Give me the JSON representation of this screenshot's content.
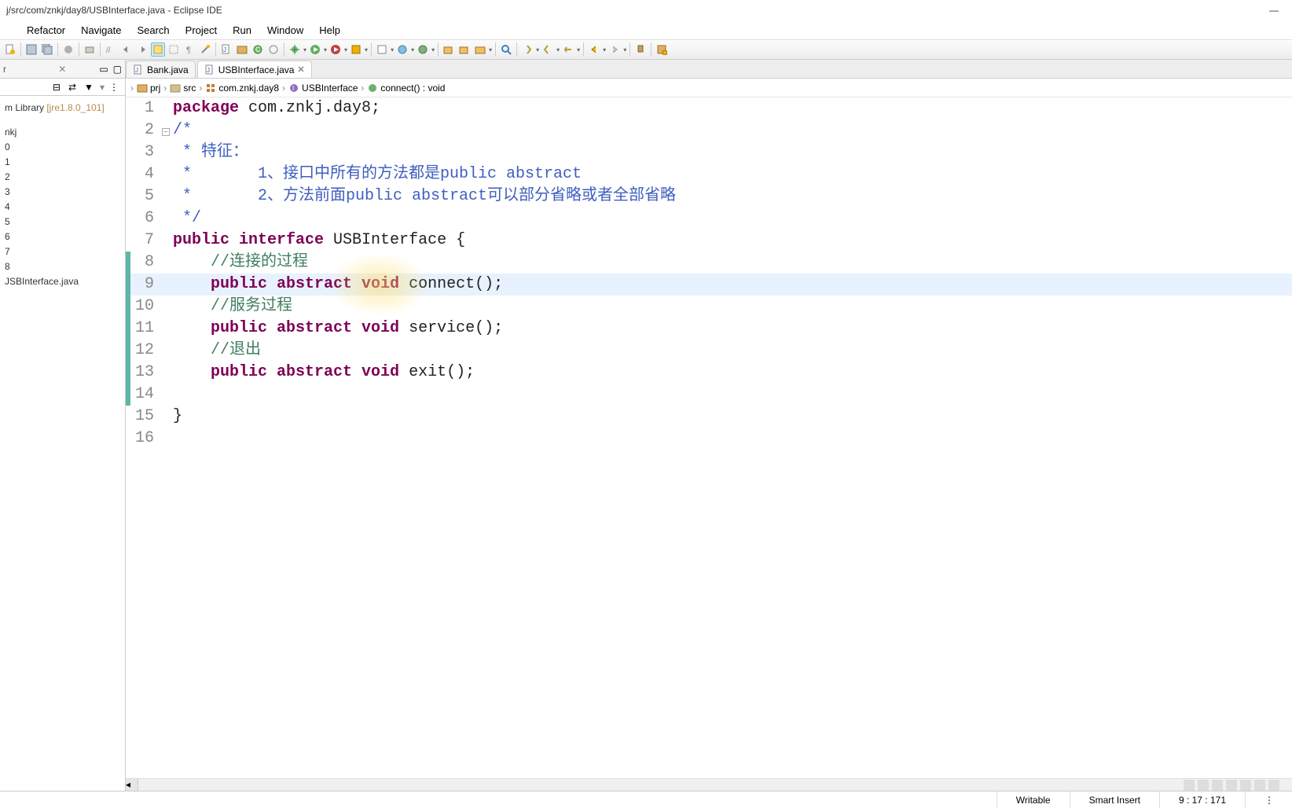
{
  "title": "j/src/com/znkj/day8/USBInterface.java - Eclipse IDE",
  "menubar": [
    "",
    "Refactor",
    "Navigate",
    "Search",
    "Project",
    "Run",
    "Window",
    "Help"
  ],
  "sidebar": {
    "jre_label": "m Library ",
    "jre_version": "[jre1.8.0_101]",
    "items": [
      "nkj",
      "0",
      "1",
      "2",
      "3",
      "4",
      "5",
      "6",
      "7",
      "8"
    ],
    "file": "JSBInterface.java"
  },
  "tabs": [
    {
      "label": "Bank.java",
      "active": false
    },
    {
      "label": "USBInterface.java",
      "active": true
    }
  ],
  "breadcrumb": [
    "prj",
    "src",
    "com.znkj.day8",
    "USBInterface",
    "connect() : void"
  ],
  "code": {
    "lines": [
      {
        "n": 1,
        "segments": [
          {
            "t": "package ",
            "cls": "k"
          },
          {
            "t": "com.znkj.day8;",
            "cls": ""
          }
        ]
      },
      {
        "n": 2,
        "fold": true,
        "segments": [
          {
            "t": "/*",
            "cls": "c2"
          }
        ]
      },
      {
        "n": 3,
        "segments": [
          {
            "t": " * 特征：",
            "cls": "c2"
          }
        ]
      },
      {
        "n": 4,
        "segments": [
          {
            "t": " *       1、接口中所有的方法都是public abstract",
            "cls": "c2"
          }
        ]
      },
      {
        "n": 5,
        "segments": [
          {
            "t": " *       2、方法前面public abstract可以部分省略或者全部省略",
            "cls": "c2"
          }
        ]
      },
      {
        "n": 6,
        "segments": [
          {
            "t": " */",
            "cls": "c2"
          }
        ]
      },
      {
        "n": 7,
        "segments": [
          {
            "t": "public interface ",
            "cls": "k"
          },
          {
            "t": "USBInterface {",
            "cls": ""
          }
        ]
      },
      {
        "n": 8,
        "bar": "teal",
        "segments": [
          {
            "t": "    ",
            "cls": ""
          },
          {
            "t": "//连接的过程",
            "cls": "c"
          }
        ]
      },
      {
        "n": 9,
        "bar": "teal",
        "hl": true,
        "segments": [
          {
            "t": "    ",
            "cls": ""
          },
          {
            "t": "public abstract void ",
            "cls": "k"
          },
          {
            "t": "connect();",
            "cls": ""
          }
        ]
      },
      {
        "n": 10,
        "bar": "teal",
        "segments": [
          {
            "t": "    ",
            "cls": ""
          },
          {
            "t": "//服务过程",
            "cls": "c"
          }
        ]
      },
      {
        "n": 11,
        "bar": "teal",
        "segments": [
          {
            "t": "    ",
            "cls": ""
          },
          {
            "t": "public abstract void ",
            "cls": "k"
          },
          {
            "t": "service();",
            "cls": ""
          }
        ]
      },
      {
        "n": 12,
        "bar": "teal",
        "segments": [
          {
            "t": "    ",
            "cls": ""
          },
          {
            "t": "//退出",
            "cls": "c"
          }
        ]
      },
      {
        "n": 13,
        "bar": "teal",
        "segments": [
          {
            "t": "    ",
            "cls": ""
          },
          {
            "t": "public abstract void ",
            "cls": "k"
          },
          {
            "t": "exit();",
            "cls": ""
          }
        ]
      },
      {
        "n": 14,
        "bar": "teal",
        "segments": [
          {
            "t": "",
            "cls": ""
          }
        ]
      },
      {
        "n": 15,
        "segments": [
          {
            "t": "}",
            "cls": ""
          }
        ]
      },
      {
        "n": 16,
        "segments": [
          {
            "t": "",
            "cls": ""
          }
        ]
      }
    ]
  },
  "status": {
    "writable": "Writable",
    "insert": "Smart Insert",
    "pos": "9 : 17 : 171"
  },
  "window_buttons": {
    "min": "—"
  }
}
